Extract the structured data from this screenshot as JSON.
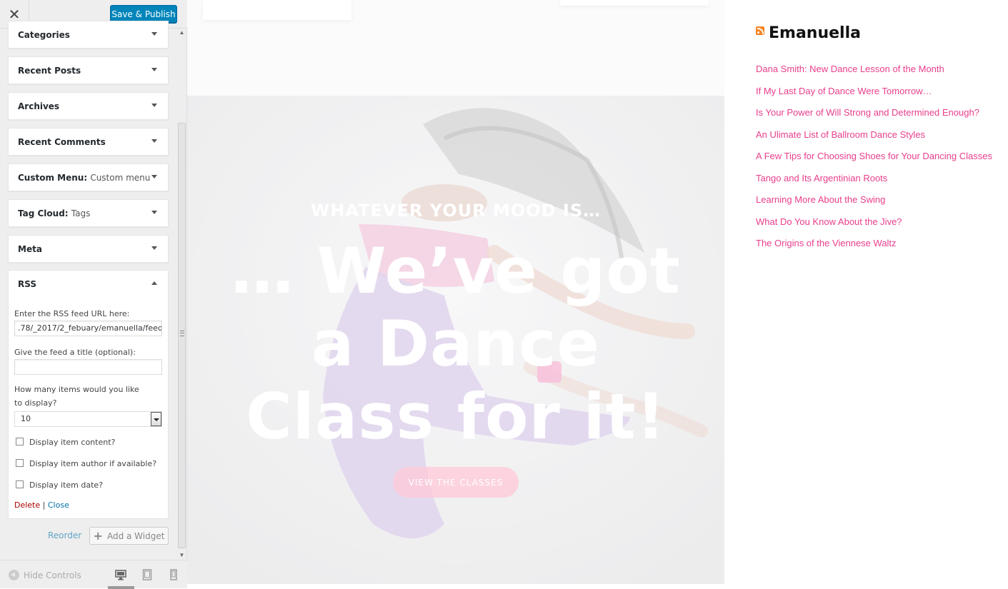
{
  "toolbar": {
    "close_glyph": "✕",
    "save_label": "Save & Publish"
  },
  "widgets": [
    {
      "title": "Categories",
      "sub": ""
    },
    {
      "title": "Recent Posts",
      "sub": ""
    },
    {
      "title": "Archives",
      "sub": ""
    },
    {
      "title": "Recent Comments",
      "sub": ""
    },
    {
      "title": "Custom Menu:",
      "sub": "Custom menu"
    },
    {
      "title": "Tag Cloud:",
      "sub": "Tags"
    },
    {
      "title": "Meta",
      "sub": ""
    }
  ],
  "rss_widget": {
    "title": "RSS",
    "url_label": "Enter the RSS feed URL here:",
    "url_value": ".78/_2017/2_febuary/emanuella/feed",
    "feed_title_label": "Give the feed a title (optional):",
    "feed_title_value": "",
    "items_label": "How many items would you like to display?",
    "items_value": "10",
    "checkboxes": [
      {
        "label": "Display item content?",
        "checked": false
      },
      {
        "label": "Display item author if available?",
        "checked": false
      },
      {
        "label": "Display item date?",
        "checked": false
      }
    ],
    "delete_label": "Delete",
    "separator": "|",
    "close_label": "Close"
  },
  "actions": {
    "reorder_label": "Reorder",
    "add_widget_label": "Add a Widget"
  },
  "footer": {
    "hide_controls_label": "Hide Controls"
  },
  "preview": {
    "hero_sub": "WHATEVER YOUR MOOD IS…",
    "hero_title": "… We’ve got a Dance Class for it!",
    "hero_button": "VIEW THE CLASSES",
    "rss_title": "Emanuella",
    "rss_items": [
      "Dana Smith: New Dance Lesson of the Month",
      "If My Last Day of Dance Were Tomorrow…",
      "Is Your Power of Will Strong and Determined Enough?",
      "An Ulimate List of Ballroom Dance Styles",
      "A Few Tips for Choosing Shoes for Your Dancing Classes",
      "Tango and Its Argentinian Roots",
      "Learning More About the Swing",
      "What Do You Know About the Jive?",
      "The Origins of the Viennese Waltz"
    ]
  },
  "colors": {
    "accent": "#0085ba",
    "link_pink": "#e83e8c",
    "delete_red": "#aa0000",
    "link_blue": "#0073aa"
  }
}
